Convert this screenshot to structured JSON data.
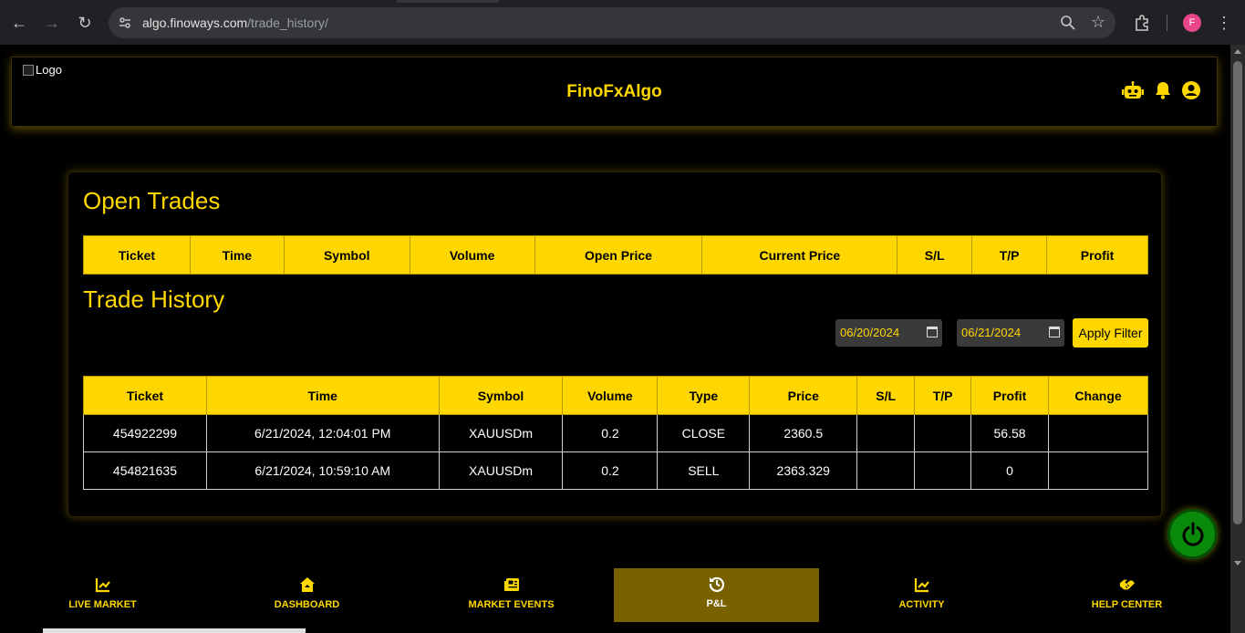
{
  "browser": {
    "url_host": "algo.finoways.com",
    "url_path": "/trade_history/",
    "profile_initial": "F"
  },
  "header": {
    "logo_alt": "Logo",
    "brand": "FinoFxAlgo"
  },
  "open_trades": {
    "title": "Open Trades",
    "columns": [
      "Ticket",
      "Time",
      "Symbol",
      "Volume",
      "Open Price",
      "Current Price",
      "S/L",
      "T/P",
      "Profit"
    ]
  },
  "trade_history": {
    "title": "Trade History",
    "from_date": "06/20/2024",
    "to_date": "06/21/2024",
    "apply_label": "Apply Filter",
    "columns": [
      "Ticket",
      "Time",
      "Symbol",
      "Volume",
      "Type",
      "Price",
      "S/L",
      "T/P",
      "Profit",
      "Change"
    ],
    "rows": [
      [
        "454922299",
        "6/21/2024, 12:04:01 PM",
        "XAUUSDm",
        "0.2",
        "CLOSE",
        "2360.5",
        "",
        "",
        "56.58",
        ""
      ],
      [
        "454821635",
        "6/21/2024, 10:59:10 AM",
        "XAUUSDm",
        "0.2",
        "SELL",
        "2363.329",
        "",
        "",
        "0",
        ""
      ]
    ]
  },
  "bottom_nav": [
    {
      "label": "LIVE MARKET",
      "icon": "chart-line-icon"
    },
    {
      "label": "DASHBOARD",
      "icon": "home-icon"
    },
    {
      "label": "MARKET EVENTS",
      "icon": "newspaper-icon"
    },
    {
      "label": "P&L",
      "icon": "history-icon",
      "active": true
    },
    {
      "label": "ACTIVITY",
      "icon": "chart-line-icon"
    },
    {
      "label": "HELP CENTER",
      "icon": "handshake-icon"
    }
  ],
  "colors": {
    "accent": "#ffd700",
    "active_nav": "#7a6100",
    "power": "#0a8a0a"
  }
}
